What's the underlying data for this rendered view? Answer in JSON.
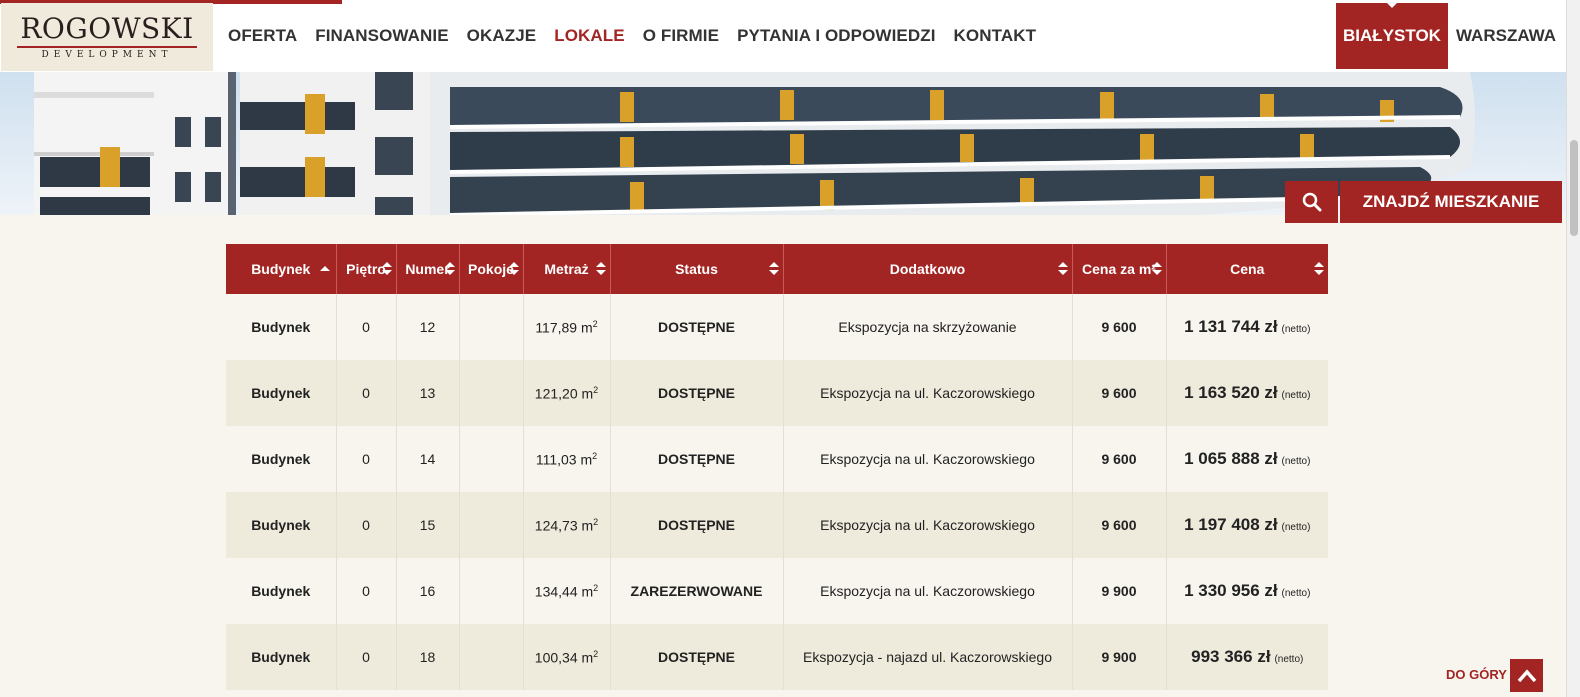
{
  "logo": {
    "main": "ROGOWSKI",
    "sub": "DEVELOPMENT"
  },
  "nav": [
    "OFERTA",
    "FINANSOWANIE",
    "OKAZJE",
    "LOKALE",
    "O FIRMIE",
    "PYTANIA I ODPOWIEDZI",
    "KONTAKT"
  ],
  "nav_active": "LOKALE",
  "cities": {
    "bialystok": "BIAŁYSTOK",
    "warszawa": "WARSZAWA"
  },
  "find_button": "ZNAJDŹ MIESZKANIE",
  "table": {
    "headers": [
      "Budynek",
      "Piętro",
      "Numer",
      "Pokoje",
      "Metraż",
      "Status",
      "Dodatkowo",
      "Cena za m²",
      "Cena"
    ],
    "rows": [
      {
        "budynek": "Budynek",
        "pietro": "0",
        "numer": "12",
        "pokoje": "",
        "metraz": "117,89 m",
        "status": "DOSTĘPNE",
        "dodatkowo": "Ekspozycja na skrzyżowanie",
        "cena_m2": "9 600",
        "cena": "1 131 744 zł",
        "netto": "(netto)"
      },
      {
        "budynek": "Budynek",
        "pietro": "0",
        "numer": "13",
        "pokoje": "",
        "metraz": "121,20 m",
        "status": "DOSTĘPNE",
        "dodatkowo": "Ekspozycja na ul. Kaczorowskiego",
        "cena_m2": "9 600",
        "cena": "1 163 520 zł",
        "netto": "(netto)"
      },
      {
        "budynek": "Budynek",
        "pietro": "0",
        "numer": "14",
        "pokoje": "",
        "metraz": "111,03 m",
        "status": "DOSTĘPNE",
        "dodatkowo": "Ekspozycja na ul. Kaczorowskiego",
        "cena_m2": "9 600",
        "cena": "1 065 888 zł",
        "netto": "(netto)"
      },
      {
        "budynek": "Budynek",
        "pietro": "0",
        "numer": "15",
        "pokoje": "",
        "metraz": "124,73 m",
        "status": "DOSTĘPNE",
        "dodatkowo": "Ekspozycja na ul. Kaczorowskiego",
        "cena_m2": "9 600",
        "cena": "1 197 408 zł",
        "netto": "(netto)"
      },
      {
        "budynek": "Budynek",
        "pietro": "0",
        "numer": "16",
        "pokoje": "",
        "metraz": "134,44 m",
        "status": "ZAREZERWOWANE",
        "dodatkowo": "Ekspozycja na ul. Kaczorowskiego",
        "cena_m2": "9 900",
        "cena": "1 330 956 zł",
        "netto": "(netto)"
      },
      {
        "budynek": "Budynek",
        "pietro": "0",
        "numer": "18",
        "pokoje": "",
        "metraz": "100,34 m",
        "status": "DOSTĘPNE",
        "dodatkowo": "Ekspozycja - najazd ul. Kaczorowskiego",
        "cena_m2": "9 900",
        "cena": "993 366 zł",
        "netto": "(netto)"
      }
    ]
  },
  "back_to_top": "DO GÓRY",
  "colors": {
    "brand": "#a32523",
    "available": "#8cc63e"
  }
}
